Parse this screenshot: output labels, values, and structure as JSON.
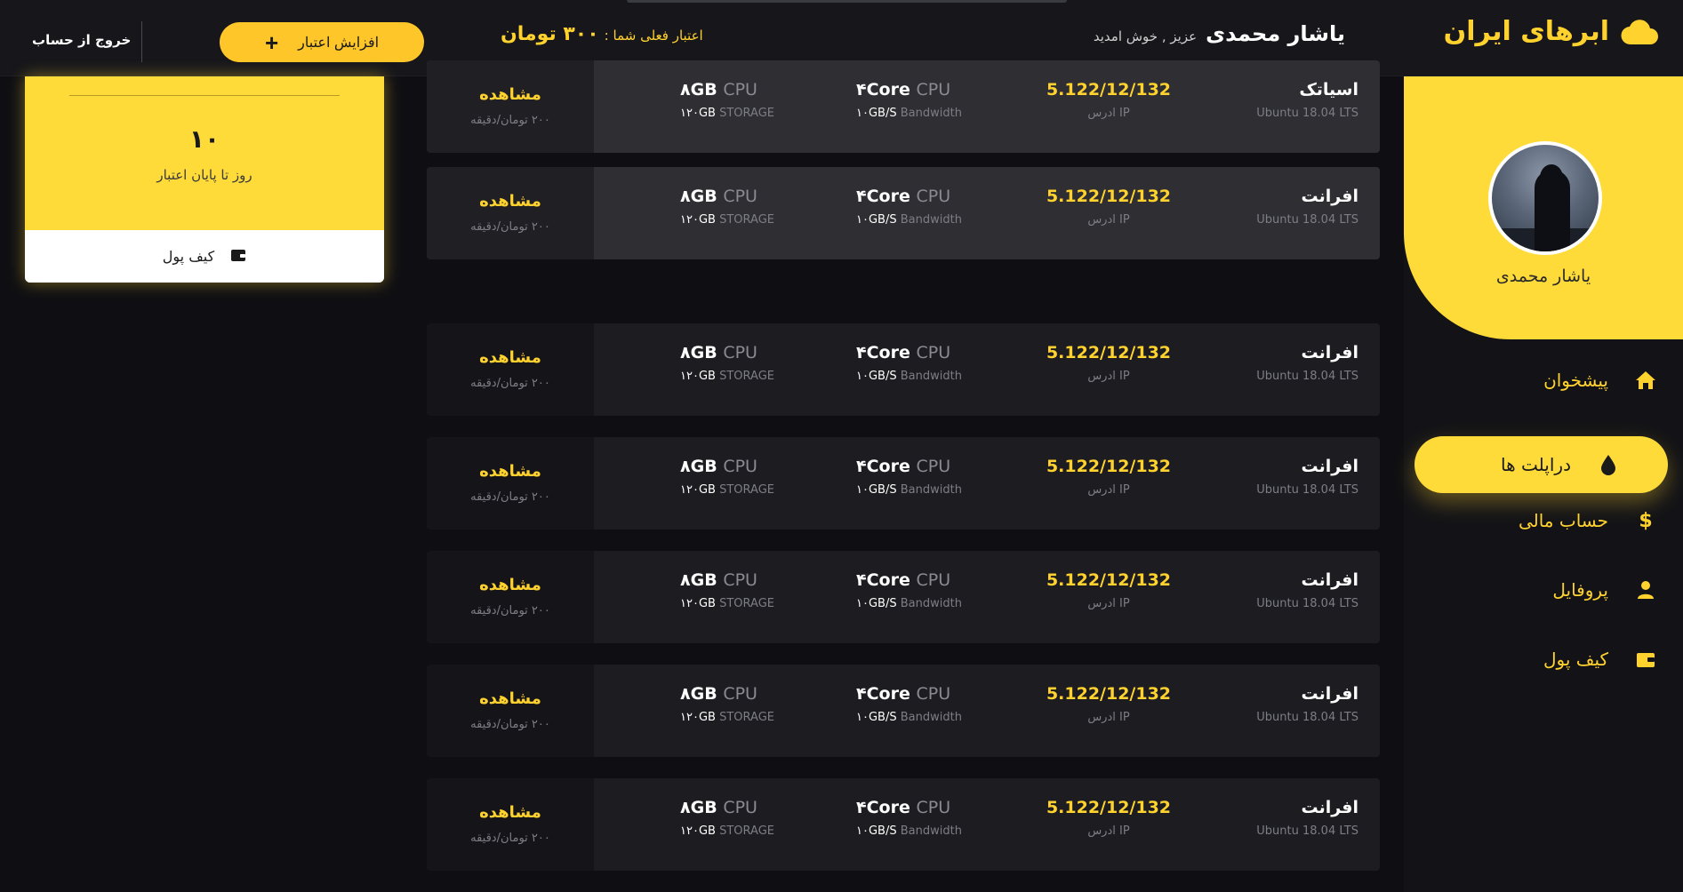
{
  "header": {
    "brand": "ابرهای ایران",
    "user_name": "یاشار محمدی",
    "greeting": "عزیز , خوش امدید",
    "credit_label": "اعتبار فعلی شما :",
    "credit_amount": "۳۰۰ تومان",
    "add_credit_label": "افزایش اعتبار",
    "logout_label": "خروج از حساب"
  },
  "sidebar": {
    "profile_name": "یاشار محمدی",
    "items": [
      {
        "label": "پیشخوان",
        "icon": "home-icon"
      },
      {
        "label": "دراپلت ها",
        "icon": "droplet-icon",
        "active": true
      },
      {
        "label": "حساب مالی",
        "icon": "dollar-icon"
      },
      {
        "label": "پروفایل",
        "icon": "user-icon"
      },
      {
        "label": "کیف پول",
        "icon": "wallet-icon"
      }
    ]
  },
  "wallet_card": {
    "days": "۱۰",
    "days_label": "روز تا پایان اعتبار",
    "footer_label": "کیف پول"
  },
  "droplets": [
    {
      "name": "اسیاتک",
      "os": "Ubuntu 18.04 LTS",
      "ip": "5.122/12/132",
      "ip_label": "ادرس IP",
      "cpu": "۴Core",
      "cpu_unit": "CPU",
      "bandwidth": "۱۰GB/S",
      "bandwidth_label": "Bandwidth",
      "ram": "۸GB",
      "ram_unit": "CPU",
      "storage": "۱۲۰GB",
      "storage_label": "STORAGE",
      "view": "مشاهده",
      "price": "۲۰۰ تومان/دقیقه"
    },
    {
      "name": "افرانت",
      "os": "Ubuntu 18.04 LTS",
      "ip": "5.122/12/132",
      "ip_label": "ادرس IP",
      "cpu": "۴Core",
      "cpu_unit": "CPU",
      "bandwidth": "۱۰GB/S",
      "bandwidth_label": "Bandwidth",
      "ram": "۸GB",
      "ram_unit": "CPU",
      "storage": "۱۲۰GB",
      "storage_label": "STORAGE",
      "view": "مشاهده",
      "price": "۲۰۰ تومان/دقیقه"
    },
    {
      "name": "افرانت",
      "os": "Ubuntu 18.04 LTS",
      "ip": "5.122/12/132",
      "ip_label": "ادرس IP",
      "cpu": "۴Core",
      "cpu_unit": "CPU",
      "bandwidth": "۱۰GB/S",
      "bandwidth_label": "Bandwidth",
      "ram": "۸GB",
      "ram_unit": "CPU",
      "storage": "۱۲۰GB",
      "storage_label": "STORAGE",
      "view": "مشاهده",
      "price": "۲۰۰ تومان/دقیقه"
    },
    {
      "name": "افرانت",
      "os": "Ubuntu 18.04 LTS",
      "ip": "5.122/12/132",
      "ip_label": "ادرس IP",
      "cpu": "۴Core",
      "cpu_unit": "CPU",
      "bandwidth": "۱۰GB/S",
      "bandwidth_label": "Bandwidth",
      "ram": "۸GB",
      "ram_unit": "CPU",
      "storage": "۱۲۰GB",
      "storage_label": "STORAGE",
      "view": "مشاهده",
      "price": "۲۰۰ تومان/دقیقه"
    },
    {
      "name": "افرانت",
      "os": "Ubuntu 18.04 LTS",
      "ip": "5.122/12/132",
      "ip_label": "ادرس IP",
      "cpu": "۴Core",
      "cpu_unit": "CPU",
      "bandwidth": "۱۰GB/S",
      "bandwidth_label": "Bandwidth",
      "ram": "۸GB",
      "ram_unit": "CPU",
      "storage": "۱۲۰GB",
      "storage_label": "STORAGE",
      "view": "مشاهده",
      "price": "۲۰۰ تومان/دقیقه"
    },
    {
      "name": "افرانت",
      "os": "Ubuntu 18.04 LTS",
      "ip": "5.122/12/132",
      "ip_label": "ادرس IP",
      "cpu": "۴Core",
      "cpu_unit": "CPU",
      "bandwidth": "۱۰GB/S",
      "bandwidth_label": "Bandwidth",
      "ram": "۸GB",
      "ram_unit": "CPU",
      "storage": "۱۲۰GB",
      "storage_label": "STORAGE",
      "view": "مشاهده",
      "price": "۲۰۰ تومان/دقیقه"
    },
    {
      "name": "افرانت",
      "os": "Ubuntu 18.04 LTS",
      "ip": "5.122/12/132",
      "ip_label": "ادرس IP",
      "cpu": "۴Core",
      "cpu_unit": "CPU",
      "bandwidth": "۱۰GB/S",
      "bandwidth_label": "Bandwidth",
      "ram": "۸GB",
      "ram_unit": "CPU",
      "storage": "۱۲۰GB",
      "storage_label": "STORAGE",
      "view": "مشاهده",
      "price": "۲۰۰ تومان/دقیقه"
    }
  ],
  "colors": {
    "accent": "#ffd22e",
    "background": "#0f0f13",
    "row": "#1c1c21",
    "row_highlight": "#2e2e33"
  }
}
